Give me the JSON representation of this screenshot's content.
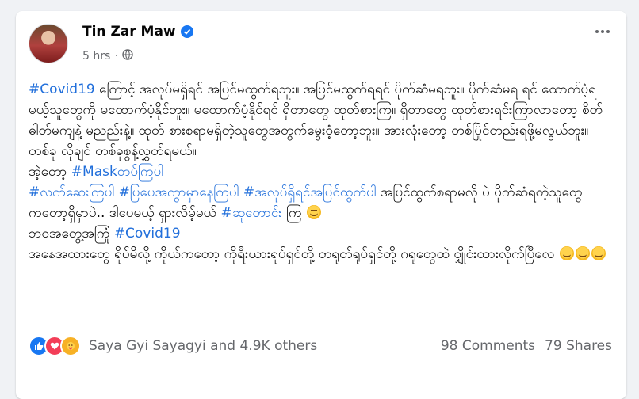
{
  "post": {
    "author": "Tin Zar Maw",
    "time": "5 hrs",
    "privacy_icon": "globe-icon",
    "verified_icon": "verified-badge-icon",
    "more_icon": "more-options-icon",
    "paragraphs": {
      "p1_tag": "#Covid19",
      "p1_text": " ကြောင့် အလုပ်မရှိရင် အပြင်မထွက်ရဘူး။ အပြင်မထွက်ရရင် ပိုက်ဆံမရဘူး။ ပိုက်ဆံမရ ရင် ထောက်ပံ့ရမယ့်သူတွေကို မထောက်ပံ့နိုင်ဘူး။ မထောက်ပံ့နိုင်ရင် ရှိတာတွေ ထုတ်စားကြ။ ရှိတာတွေ ထုတ်စားရင်းကြာလာတော့ စိတ်ဓါတ်မကျနဲ့ မညည်းနဲ့။ ထုတ် စားစရာမရှိတဲ့သူတွေအတွက်မွေးဝံ့တော့ဘူး။ အားလုံးတော့ တစ်ပြိုင်တည်းရဖို့မလွယ်ဘူး။ တစ်ခု လိုချင် တစ်ခုစွန့်လွှတ်ရမယ်။",
      "p2_text": "အဲ့တော့ ",
      "p2_tag": "#Maskတပ်ကြပါ",
      "p3_tag1": "#လက်ဆေးကြပါ",
      "p3_tag2": "#ပြပေအကွာမှာနေကြပါ",
      "p3_tag3": "#အလုပ်ရှိရင်အပြင်ထွက်ပါ",
      "p3_text": " အပြင်ထွက်စရာမလို ပဲ ပိုက်ဆံရတဲ့သူတွေကတော့ရှိမှာပဲ.. ဒါပေမယ့် ရှားလိမ့်မယ် ",
      "p3_tag4": "#ဆုတောင်း",
      "p3_tail": " ကြ ",
      "p4_text": "ဘဝအတွေ့အကြုံ ",
      "p4_tag": "#Covid19",
      "p5_text": "အနေအထားတွေ ရိုပ်မိလို့ ကိုယ်ကတော့ ကိုရီးယားရုပ်ရှင်တို့ တရုတ်ရုပ်ရှင်တို့ ဂရုတွေထဲ ဝျှိုင်းထားလိုက်ပြီလေ "
    }
  },
  "reactions": {
    "icons": [
      "like-icon",
      "love-icon",
      "care-icon"
    ],
    "summary": "Saya Gyi Sayagyi and 4.9K others",
    "comments": "98 Comments",
    "shares": "79 Shares"
  }
}
